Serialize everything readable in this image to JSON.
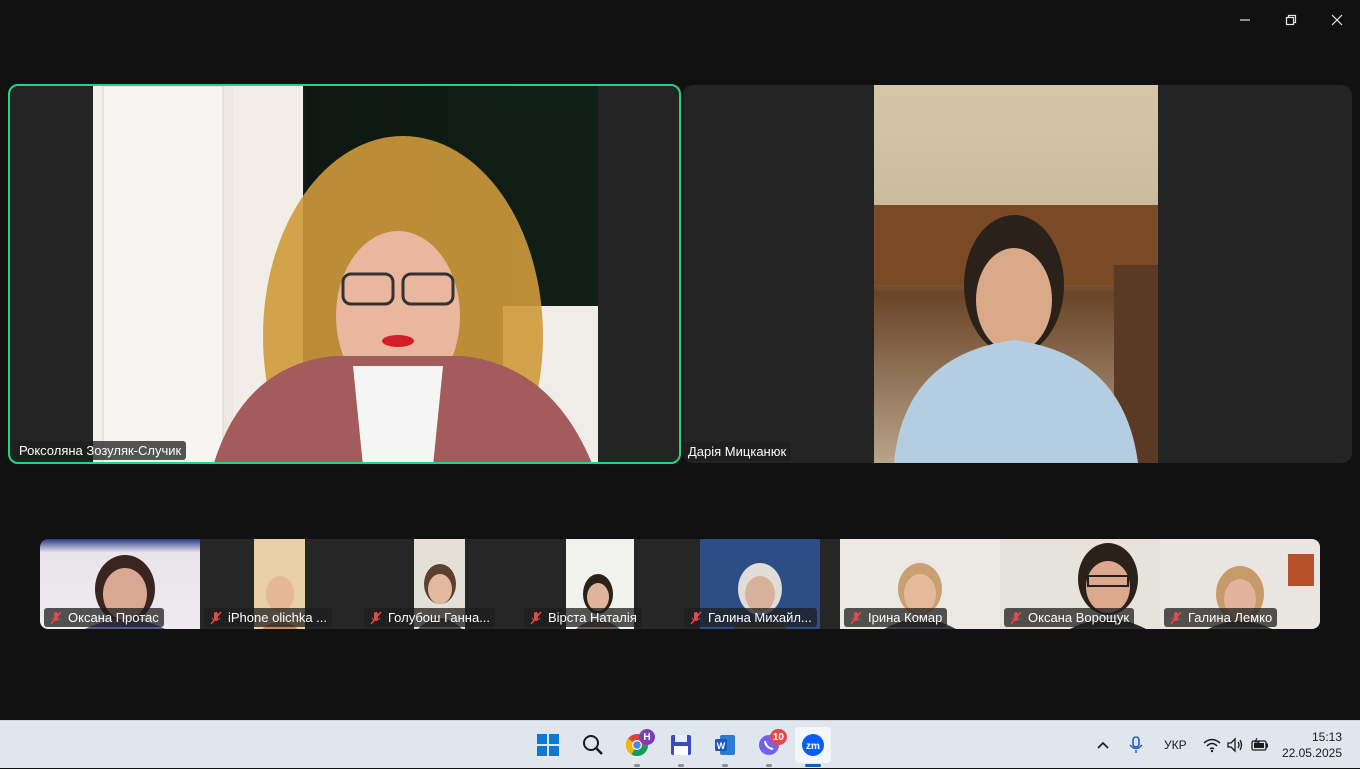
{
  "window_controls": {
    "minimize_icon": "minimize-icon",
    "restore_icon": "restore-icon",
    "close_icon": "close-icon"
  },
  "main_tiles": [
    {
      "name": "Роксоляна Зозуляк-Случик",
      "active": true
    },
    {
      "name": "Дарія Мицканюк",
      "active": false
    }
  ],
  "thumbnails": [
    {
      "name": "Оксана Протас",
      "muted": true
    },
    {
      "name": "iPhone olichka ...",
      "muted": true
    },
    {
      "name": "Голубош Ганна...",
      "muted": true
    },
    {
      "name": "Вірста Наталія",
      "muted": true
    },
    {
      "name": "Галина Михайл...",
      "muted": true
    },
    {
      "name": "Ірина Комар",
      "muted": true
    },
    {
      "name": "Оксана Ворощук",
      "muted": true
    },
    {
      "name": "Галина Лемко",
      "muted": true
    }
  ],
  "taskbar": {
    "apps": [
      {
        "name": "windows-start-icon"
      },
      {
        "name": "search-icon"
      },
      {
        "name": "chrome-icon",
        "badge": "H"
      },
      {
        "name": "save-app-icon"
      },
      {
        "name": "word-icon"
      },
      {
        "name": "viber-icon",
        "badge": "10"
      },
      {
        "name": "zoom-icon"
      }
    ],
    "tray": {
      "language": "УКР",
      "time": "15:13",
      "date": "22.05.2025"
    }
  },
  "colors": {
    "active_speaker_border": "#22d38a",
    "taskbar_bg": "#dfe6ee",
    "mute_red": "#e5484d"
  }
}
